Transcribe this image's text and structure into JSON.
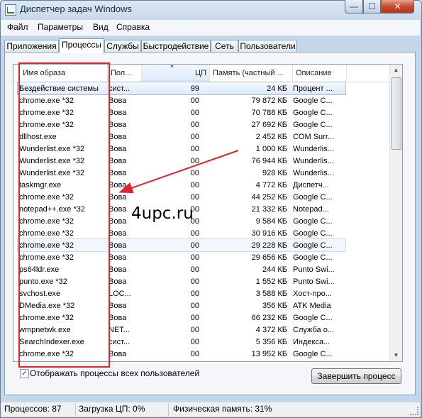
{
  "window": {
    "title": "Диспетчер задач Windows",
    "min_glyph": "—",
    "max_glyph": "☐",
    "close_glyph": "✕"
  },
  "menu": [
    "Файл",
    "Параметры",
    "Вид",
    "Справка"
  ],
  "tabs": [
    "Приложения",
    "Процессы",
    "Службы",
    "Быстродействие",
    "Сеть",
    "Пользователи"
  ],
  "active_tab": "Процессы",
  "columns": {
    "name": "Имя образа",
    "user": "Пол...",
    "cpu": "ЦП",
    "memory": "Память (частный ...",
    "description": "Описание"
  },
  "sorted_column": "ЦП",
  "processes": [
    {
      "name": "Бездействие системы",
      "user": "сист...",
      "cpu": "99",
      "mem": "24 КБ",
      "desc": "Процент ..."
    },
    {
      "name": "chrome.exe *32",
      "user": "Вова",
      "cpu": "00",
      "mem": "79 872 КБ",
      "desc": "Google C..."
    },
    {
      "name": "chrome.exe *32",
      "user": "Вова",
      "cpu": "00",
      "mem": "70 788 КБ",
      "desc": "Google C..."
    },
    {
      "name": "chrome.exe *32",
      "user": "Вова",
      "cpu": "00",
      "mem": "27 692 КБ",
      "desc": "Google C..."
    },
    {
      "name": "dllhost.exe",
      "user": "Вова",
      "cpu": "00",
      "mem": "2 452 КБ",
      "desc": "COM Surr..."
    },
    {
      "name": "Wunderlist.exe *32",
      "user": "Вова",
      "cpu": "00",
      "mem": "1 000 КБ",
      "desc": "Wunderlis..."
    },
    {
      "name": "Wunderlist.exe *32",
      "user": "Вова",
      "cpu": "00",
      "mem": "76 944 КБ",
      "desc": "Wunderlis..."
    },
    {
      "name": "Wunderlist.exe *32",
      "user": "Вова",
      "cpu": "00",
      "mem": "928 КБ",
      "desc": "Wunderlis..."
    },
    {
      "name": "taskmgr.exe",
      "user": "Вова",
      "cpu": "00",
      "mem": "4 772 КБ",
      "desc": "Диспетч..."
    },
    {
      "name": "chrome.exe *32",
      "user": "Вова",
      "cpu": "00",
      "mem": "44 252 КБ",
      "desc": "Google C..."
    },
    {
      "name": "notepad++.exe *32",
      "user": "Вова",
      "cpu": "00",
      "mem": "21 332 КБ",
      "desc": "Notepad..."
    },
    {
      "name": "chrome.exe *32",
      "user": "Вова",
      "cpu": "00",
      "mem": "9 584 КБ",
      "desc": "Google C..."
    },
    {
      "name": "chrome.exe *32",
      "user": "Вова",
      "cpu": "00",
      "mem": "30 916 КБ",
      "desc": "Google C..."
    },
    {
      "name": "chrome.exe *32",
      "user": "Вова",
      "cpu": "00",
      "mem": "29 228 КБ",
      "desc": "Google C..."
    },
    {
      "name": "chrome.exe *32",
      "user": "Вова",
      "cpu": "00",
      "mem": "29 656 КБ",
      "desc": "Google C..."
    },
    {
      "name": "ps64ldr.exe",
      "user": "Вова",
      "cpu": "00",
      "mem": "244 КБ",
      "desc": "Punto Swi..."
    },
    {
      "name": "punto.exe *32",
      "user": "Вова",
      "cpu": "00",
      "mem": "1 552 КБ",
      "desc": "Punto Swi..."
    },
    {
      "name": "svchost.exe",
      "user": "LOC...",
      "cpu": "00",
      "mem": "3 588 КБ",
      "desc": "Хост-про..."
    },
    {
      "name": "DMedia.exe *32",
      "user": "Вова",
      "cpu": "00",
      "mem": "356 КБ",
      "desc": "ATK Media"
    },
    {
      "name": "chrome.exe *32",
      "user": "Вова",
      "cpu": "00",
      "mem": "66 232 КБ",
      "desc": "Google C..."
    },
    {
      "name": "wmpnetwk.exe",
      "user": "NET...",
      "cpu": "00",
      "mem": "4 372 КБ",
      "desc": "Служба о..."
    },
    {
      "name": "SearchIndexer.exe",
      "user": "сист...",
      "cpu": "00",
      "mem": "5 356 КБ",
      "desc": "Индекса..."
    },
    {
      "name": "chrome.exe *32",
      "user": "Вова",
      "cpu": "00",
      "mem": "13 952 КБ",
      "desc": "Google C..."
    }
  ],
  "selected_row": 0,
  "hover_row": 13,
  "show_all_users": {
    "checked": true,
    "label": "Отображать процессы всех пользователей",
    "check_glyph": "✓"
  },
  "end_process_label": "Завершить процесс",
  "status": {
    "processes": "Процессов: 87",
    "cpu_load": "Загрузка ЦП: 0%",
    "physical_memory": "Физическая память: 31%"
  },
  "watermark": "4upc.ru",
  "colors": {
    "highlight_box": "#e0262b",
    "arrow": "#e0262b"
  }
}
